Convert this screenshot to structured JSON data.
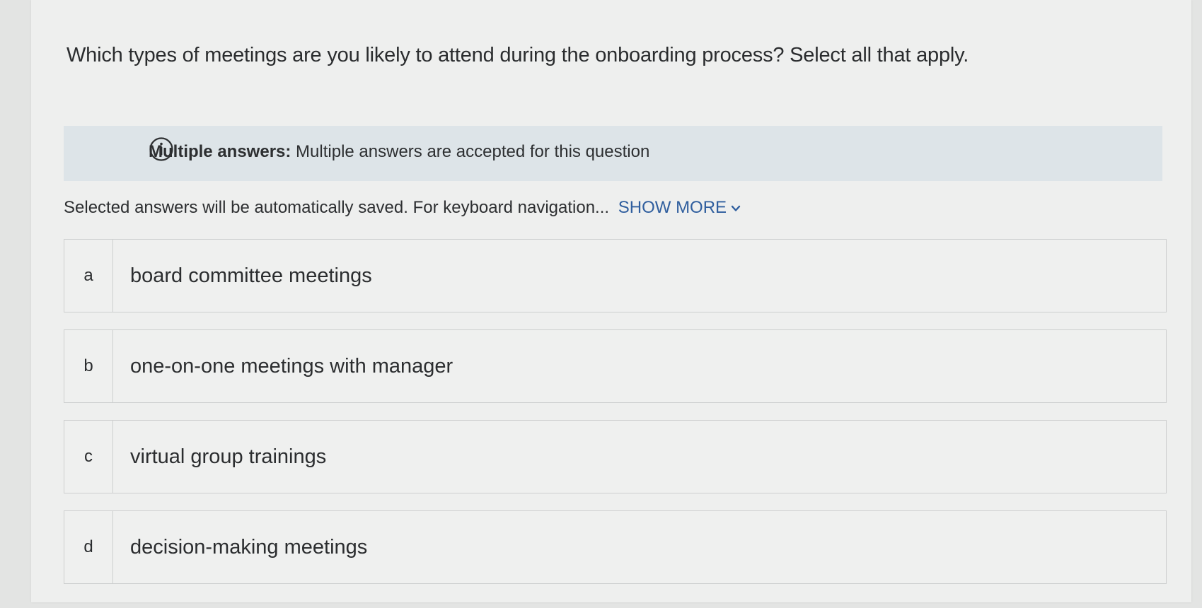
{
  "question": {
    "text": "Which types of meetings are you likely to attend during the onboarding process? Select all that apply."
  },
  "info_banner": {
    "icon": "info-icon",
    "label": "Multiple answers:",
    "text": "Multiple answers are accepted for this question"
  },
  "save_note": {
    "text": "Selected answers will be automatically saved. For keyboard navigation...",
    "show_more_label": "SHOW MORE",
    "show_more_icon": "chevron-down-icon"
  },
  "options": [
    {
      "letter": "a",
      "text": "board committee meetings"
    },
    {
      "letter": "b",
      "text": "one-on-one meetings with manager"
    },
    {
      "letter": "c",
      "text": "virtual group trainings"
    },
    {
      "letter": "d",
      "text": "decision-making meetings"
    }
  ],
  "colors": {
    "link": "#2f5e9e",
    "banner_bg": "#dde4e8",
    "page_bg": "#eeefee"
  }
}
